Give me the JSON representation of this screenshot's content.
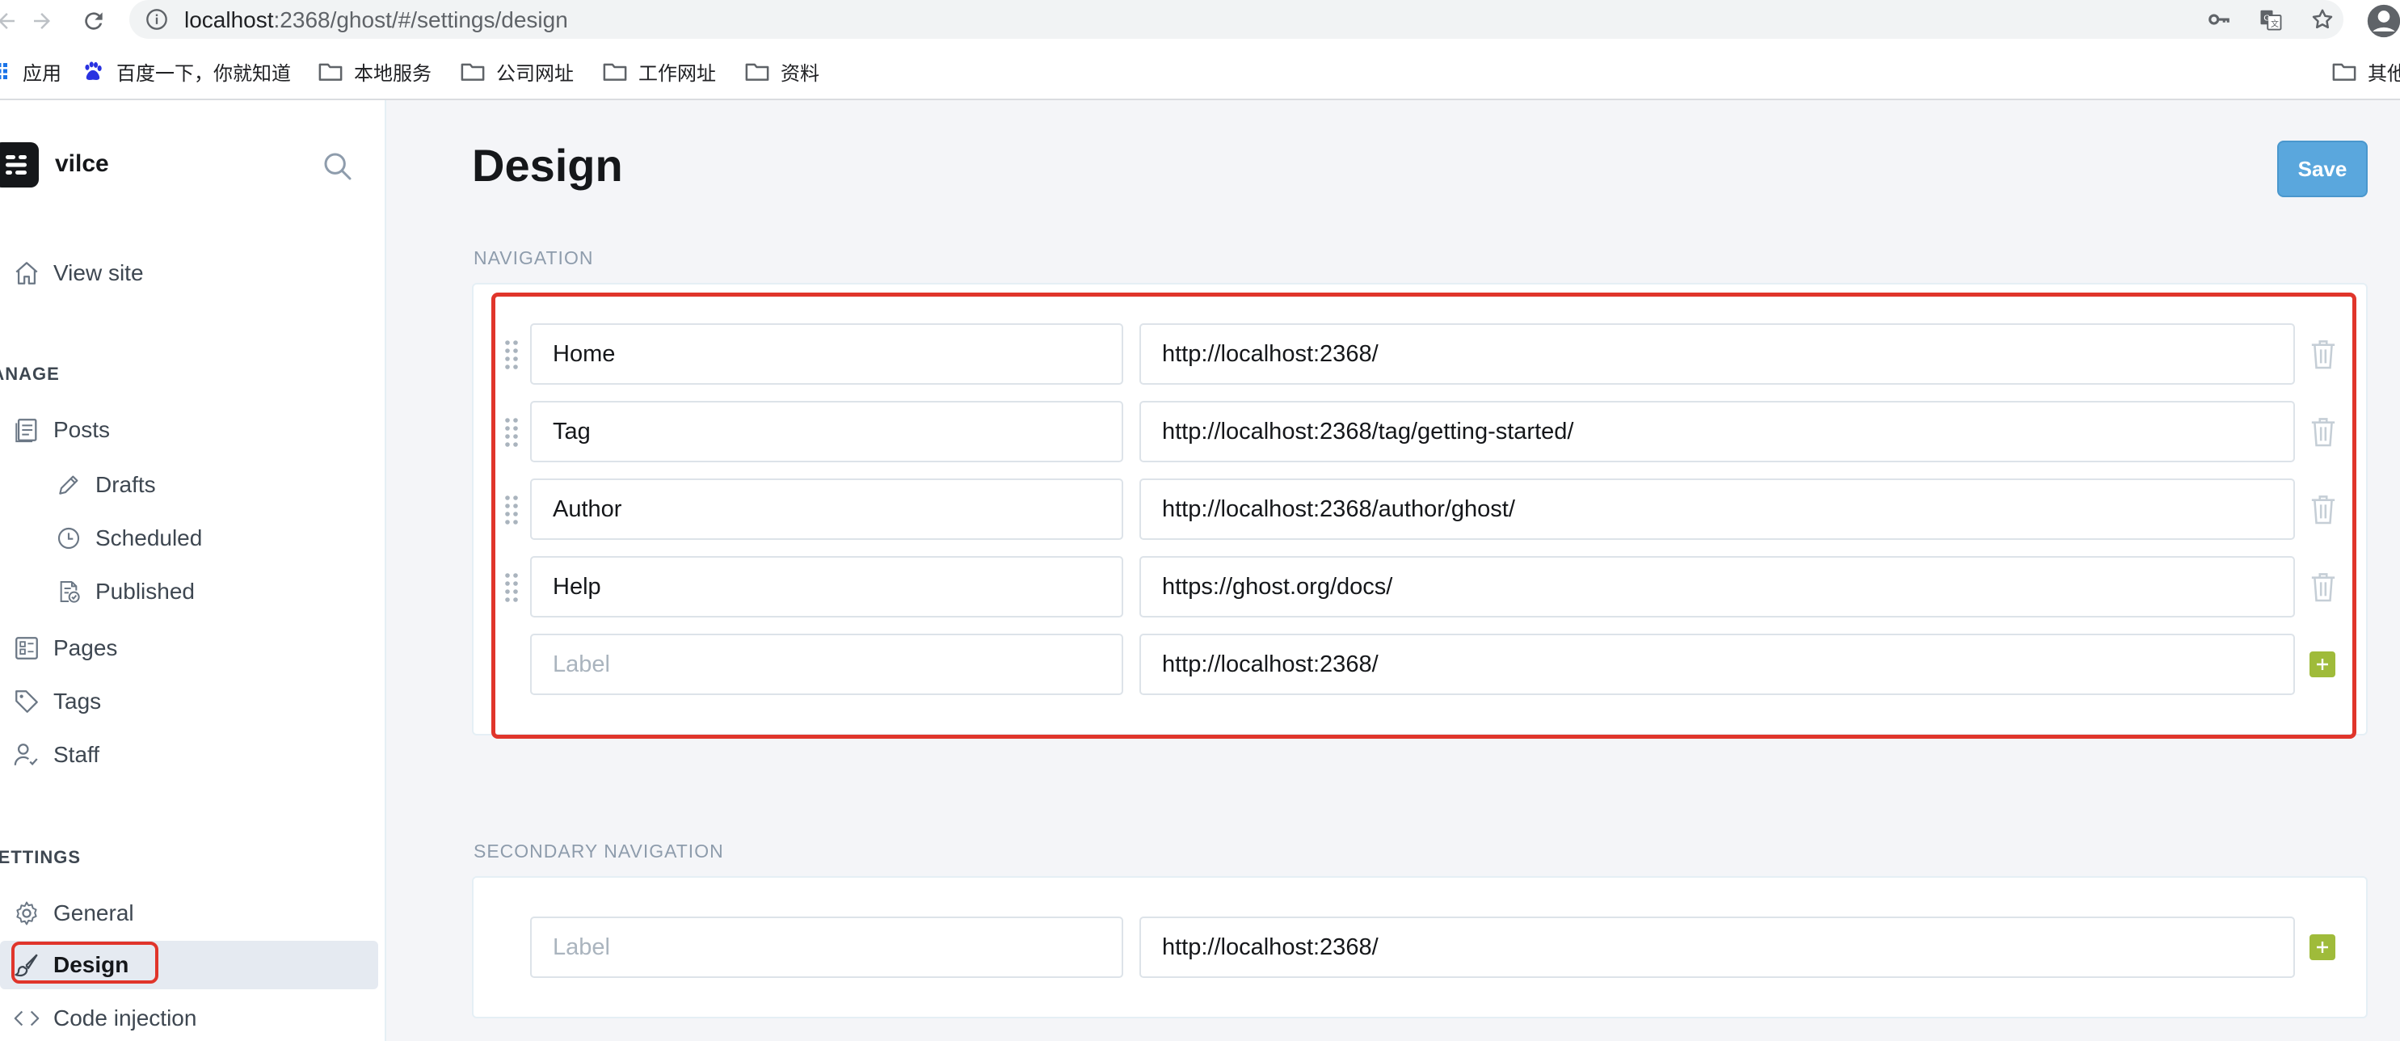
{
  "browser": {
    "url_host": "localhost",
    "url_rest": ":2368/ghost/#/settings/design",
    "bookmarks": [
      {
        "label": "应用",
        "icon": "apps-icon"
      },
      {
        "label": "百度一下，你就知道",
        "icon": "baidu-paw-icon"
      },
      {
        "label": "本地服务",
        "icon": "folder-icon"
      },
      {
        "label": "公司网址",
        "icon": "folder-icon"
      },
      {
        "label": "工作网址",
        "icon": "folder-icon"
      },
      {
        "label": "资料",
        "icon": "folder-icon"
      },
      {
        "label": "其他",
        "icon": "folder-icon"
      }
    ]
  },
  "sidebar": {
    "blog_title": "vilce",
    "view_site": "View site",
    "manage_heading": "MANAGE",
    "posts": "Posts",
    "drafts": "Drafts",
    "scheduled": "Scheduled",
    "published": "Published",
    "pages": "Pages",
    "tags": "Tags",
    "staff": "Staff",
    "settings_heading": "SETTINGS",
    "general": "General",
    "design": "Design",
    "code_injection": "Code injection"
  },
  "main": {
    "title": "Design",
    "save_label": "Save",
    "navigation": {
      "heading": "NAVIGATION",
      "items": [
        {
          "label": "Home",
          "url": "http://localhost:2368/"
        },
        {
          "label": "Tag",
          "url": "http://localhost:2368/tag/getting-started/"
        },
        {
          "label": "Author",
          "url": "http://localhost:2368/author/ghost/"
        },
        {
          "label": "Help",
          "url": "https://ghost.org/docs/"
        }
      ],
      "new_item": {
        "label_placeholder": "Label",
        "url": "http://localhost:2368/"
      }
    },
    "secondary_navigation": {
      "heading": "SECONDARY NAVIGATION",
      "new_item": {
        "label_placeholder": "Label",
        "url": "http://localhost:2368/"
      }
    }
  },
  "colors": {
    "highlight": "#e0352b",
    "save_button": "#5aa7dd",
    "add_button": "#9fbb3a"
  }
}
